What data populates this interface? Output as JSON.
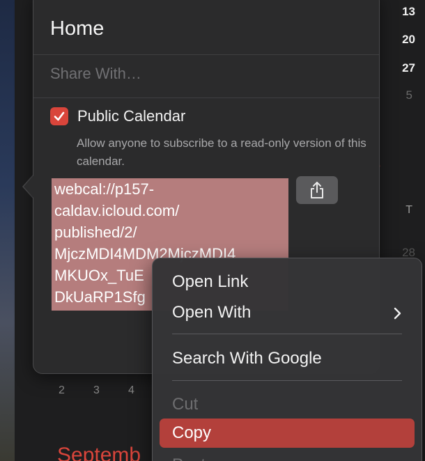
{
  "calendar": {
    "dates_right": [
      "13",
      "20",
      "27",
      "5"
    ],
    "weekday": "T",
    "date_28": "28",
    "red_letter": "e",
    "mini_days": [
      "2",
      "3",
      "4"
    ],
    "month_label": "Septemb"
  },
  "popover": {
    "title": "Home",
    "share_placeholder": "Share With…",
    "public_calendar": {
      "checked": true,
      "label": "Public Calendar",
      "description": "Allow anyone to subscribe to a read-only version of this calendar."
    },
    "url_lines": [
      "webcal://p157-",
      "caldav.icloud.com/",
      "published/2/",
      "MjczMDI4MDM2MjczMDI4",
      "MKUOx_TuE",
      "DkUaRP1Sfg"
    ],
    "share_button_icon": "share-icon"
  },
  "context_menu": {
    "items": [
      {
        "label": "Open Link",
        "enabled": true
      },
      {
        "label": "Open With",
        "enabled": true,
        "submenu": true
      },
      {
        "label": "Search With Google",
        "enabled": true
      },
      {
        "label": "Cut",
        "enabled": false
      },
      {
        "label": "Copy",
        "enabled": true,
        "highlighted": true
      },
      {
        "label": "Paste",
        "enabled": false
      }
    ]
  },
  "colors": {
    "accent_red": "#d9453b",
    "selection_bg": "#b57d7d",
    "menu_highlight": "#b3403b"
  }
}
